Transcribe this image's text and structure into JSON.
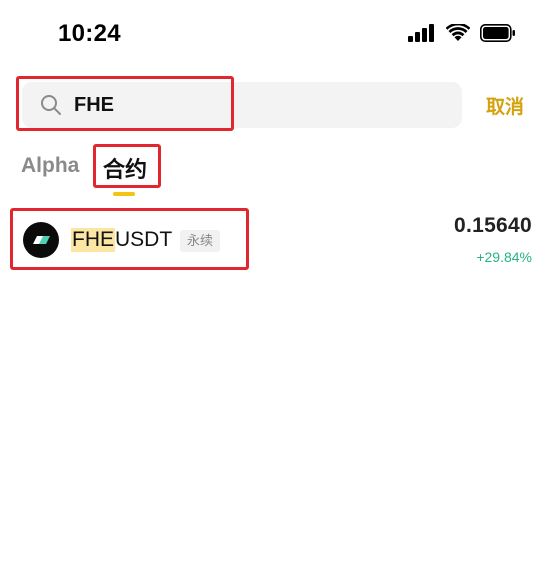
{
  "status_bar": {
    "time": "10:24",
    "icons": [
      "cellular-signal-icon",
      "wifi-icon",
      "battery-icon"
    ]
  },
  "search": {
    "value": "FHE",
    "placeholder": "",
    "cancel_label": "取消"
  },
  "tabs": [
    {
      "label": "Alpha",
      "active": false
    },
    {
      "label": "合约",
      "active": true
    }
  ],
  "results": [
    {
      "pair_highlight": "FHE",
      "pair_rest": "USDT",
      "badge": "永续",
      "price": "0.15640",
      "change": "+29.84%",
      "logo": "fhe-coin-logo"
    }
  ],
  "colors": {
    "accent": "#d4a20f",
    "tab_indicator": "#f2c413",
    "positive": "#27b383",
    "annotation_box": "#e0272e",
    "match_highlight": "#fbe6a3"
  }
}
